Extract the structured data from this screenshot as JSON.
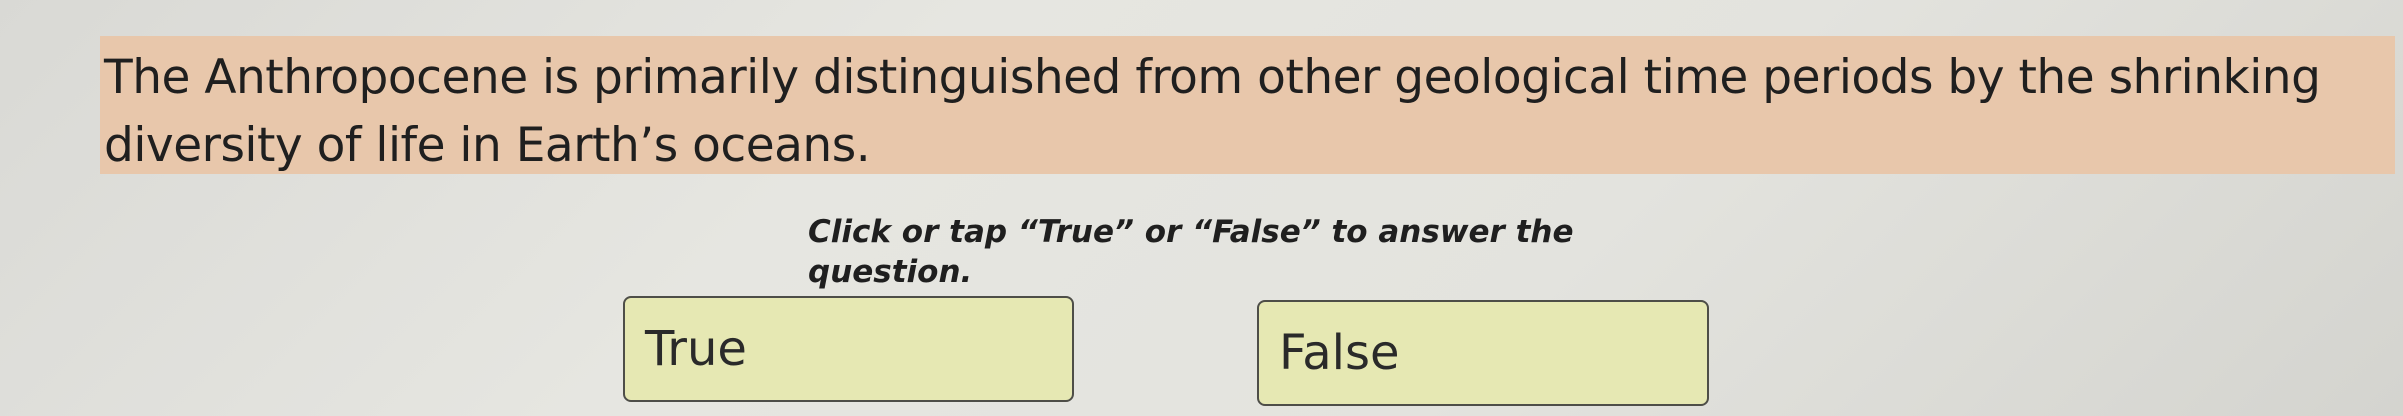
{
  "question": {
    "text": "The Anthropocene is primarily distinguished from other geological time periods by the shrinking diversity of life in Earth’s oceans."
  },
  "instruction": {
    "text": "Click or tap “True” or “False” to answer the question."
  },
  "answers": [
    {
      "label": "True"
    },
    {
      "label": "False"
    }
  ],
  "colors": {
    "question_highlight": "#e8c7ab",
    "answer_background": "#e6e8b3",
    "answer_border": "#4e4e48",
    "page_background": "#e2e2dd"
  }
}
